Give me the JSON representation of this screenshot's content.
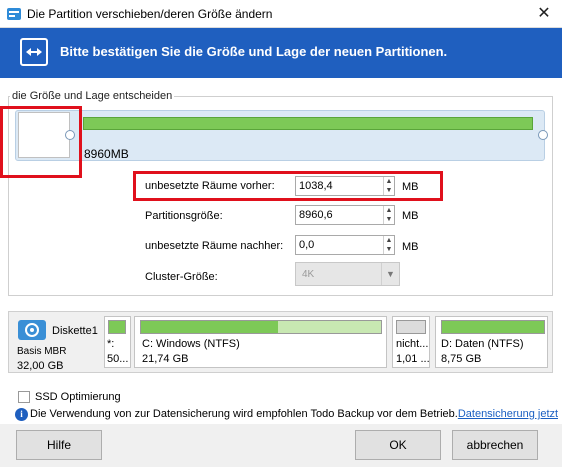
{
  "window": {
    "title": "Die Partition verschieben/deren Größe ändern",
    "close_icon": "close-icon",
    "app_icon": "partition-app-icon"
  },
  "banner": {
    "icon": "resize-arrows-icon",
    "text": "Bitte bestätigen Sie die Größe und Lage der neuen Partitionen."
  },
  "layout_group": {
    "legend": "die Größe und Lage entscheiden",
    "partition_size_label": "8960MB"
  },
  "fields": {
    "before_label": "unbesetzte Räume vorher:",
    "before_value": "1038,4",
    "partition_label": "Partitionsgröße:",
    "partition_value": "8960,6",
    "after_label": "unbesetzte Räume nachher:",
    "after_value": "0,0",
    "cluster_label": "Cluster-Größe:",
    "cluster_value": "4K",
    "unit": "MB"
  },
  "disk_map": {
    "disk_name": "Diskette1",
    "disk_type": "Basis MBR",
    "disk_size": "32,00 GB",
    "segments": [
      {
        "name": "*:",
        "size": "50..."
      },
      {
        "name": "C: Windows (NTFS)",
        "size": "21,74 GB"
      },
      {
        "name": "nicht...",
        "size": "1,01 ..."
      },
      {
        "name": "D: Daten (NTFS)",
        "size": "8,75 GB"
      }
    ]
  },
  "options": {
    "ssd_label": "SSD Optimierung",
    "ssd_checked": false,
    "info_text": "Die Verwendung von zur Datensicherung wird empfohlen Todo Backup vor dem Betrieb.",
    "info_link": "Datensicherung jetzt"
  },
  "buttons": {
    "help": "Hilfe",
    "ok": "OK",
    "cancel": "abbrechen"
  },
  "colors": {
    "accent_blue": "#1f5fbf",
    "partition_green": "#7dc957",
    "highlight_red": "#e0101c"
  }
}
